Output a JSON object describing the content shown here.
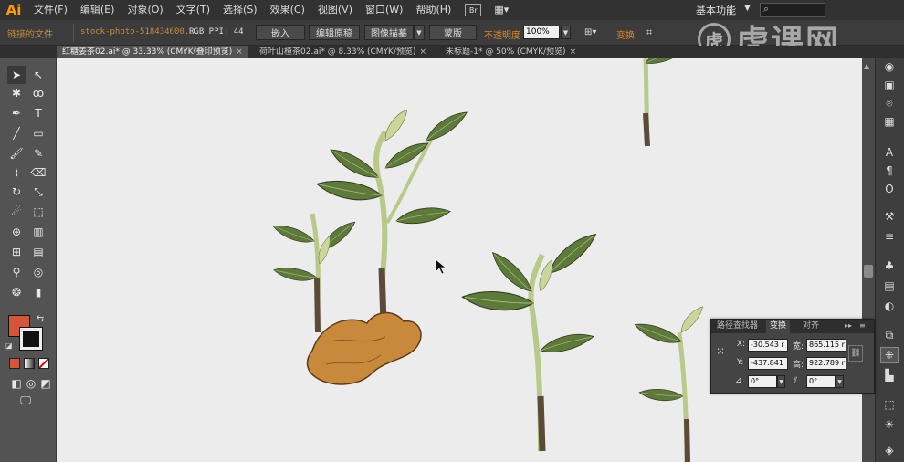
{
  "app": {
    "logo": "Ai"
  },
  "menu": {
    "items": [
      "文件(F)",
      "编辑(E)",
      "对象(O)",
      "文字(T)",
      "选择(S)",
      "效果(C)",
      "视图(V)",
      "窗口(W)",
      "帮助(H)"
    ],
    "bridge_badge": "Br",
    "workspace": "基本功能"
  },
  "control": {
    "doc_name": "链接的文件",
    "link_name": "stock-photo-518434600...",
    "color_info": "RGB  PPI: 44",
    "embed": "嵌入",
    "edit_original": "编辑原稿",
    "image_trace": "图像描摹",
    "mask": "蒙版",
    "opacity_label": "不透明度",
    "opacity_value": "100%",
    "transform": "变换"
  },
  "tabs": [
    {
      "label": "红糖姜茶02.ai* @ 33.33% (CMYK/叠印预览)",
      "active": true
    },
    {
      "label": "荷叶山楂茶02.ai* @ 8.33% (CMYK/预览)",
      "active": false
    },
    {
      "label": "未标题-1* @ 50% (CMYK/预览)",
      "active": false
    }
  ],
  "colors": {
    "fill": "#d5553a",
    "stroke": "#111111",
    "canvas": "#ececec",
    "accent": "#e0842a"
  },
  "watermark": {
    "logo_char": "虎",
    "text": "虎课网"
  },
  "transform_panel": {
    "tabs": [
      "路径查找器",
      "变换",
      "对齐"
    ],
    "x_label": "X:",
    "x_value": "-30.543 r",
    "width_label": "宽:",
    "width_value": "865.115 r",
    "y_label": "Y:",
    "y_value": "-437.841",
    "height_label": "高:",
    "height_value": "922.789 r",
    "rotate_value": "0°",
    "shear_value": "0°"
  },
  "tool_icons": [
    "selection-tool",
    "direct-selection-tool",
    "magic-wand-tool",
    "lasso-tool",
    "pen-tool",
    "type-tool",
    "line-tool",
    "rectangle-tool",
    "paintbrush-tool",
    "pencil-tool",
    "blob-brush-tool",
    "eraser-tool",
    "rotate-tool",
    "scale-tool",
    "warp-tool",
    "free-transform-tool",
    "shape-builder-tool",
    "perspective-grid-tool",
    "mesh-tool",
    "gradient-tool",
    "eyedropper-tool",
    "blend-tool",
    "symbol-sprayer-tool",
    "column-graph-tool",
    "artboard-tool",
    "slice-tool",
    "hand-tool",
    "zoom-tool"
  ]
}
